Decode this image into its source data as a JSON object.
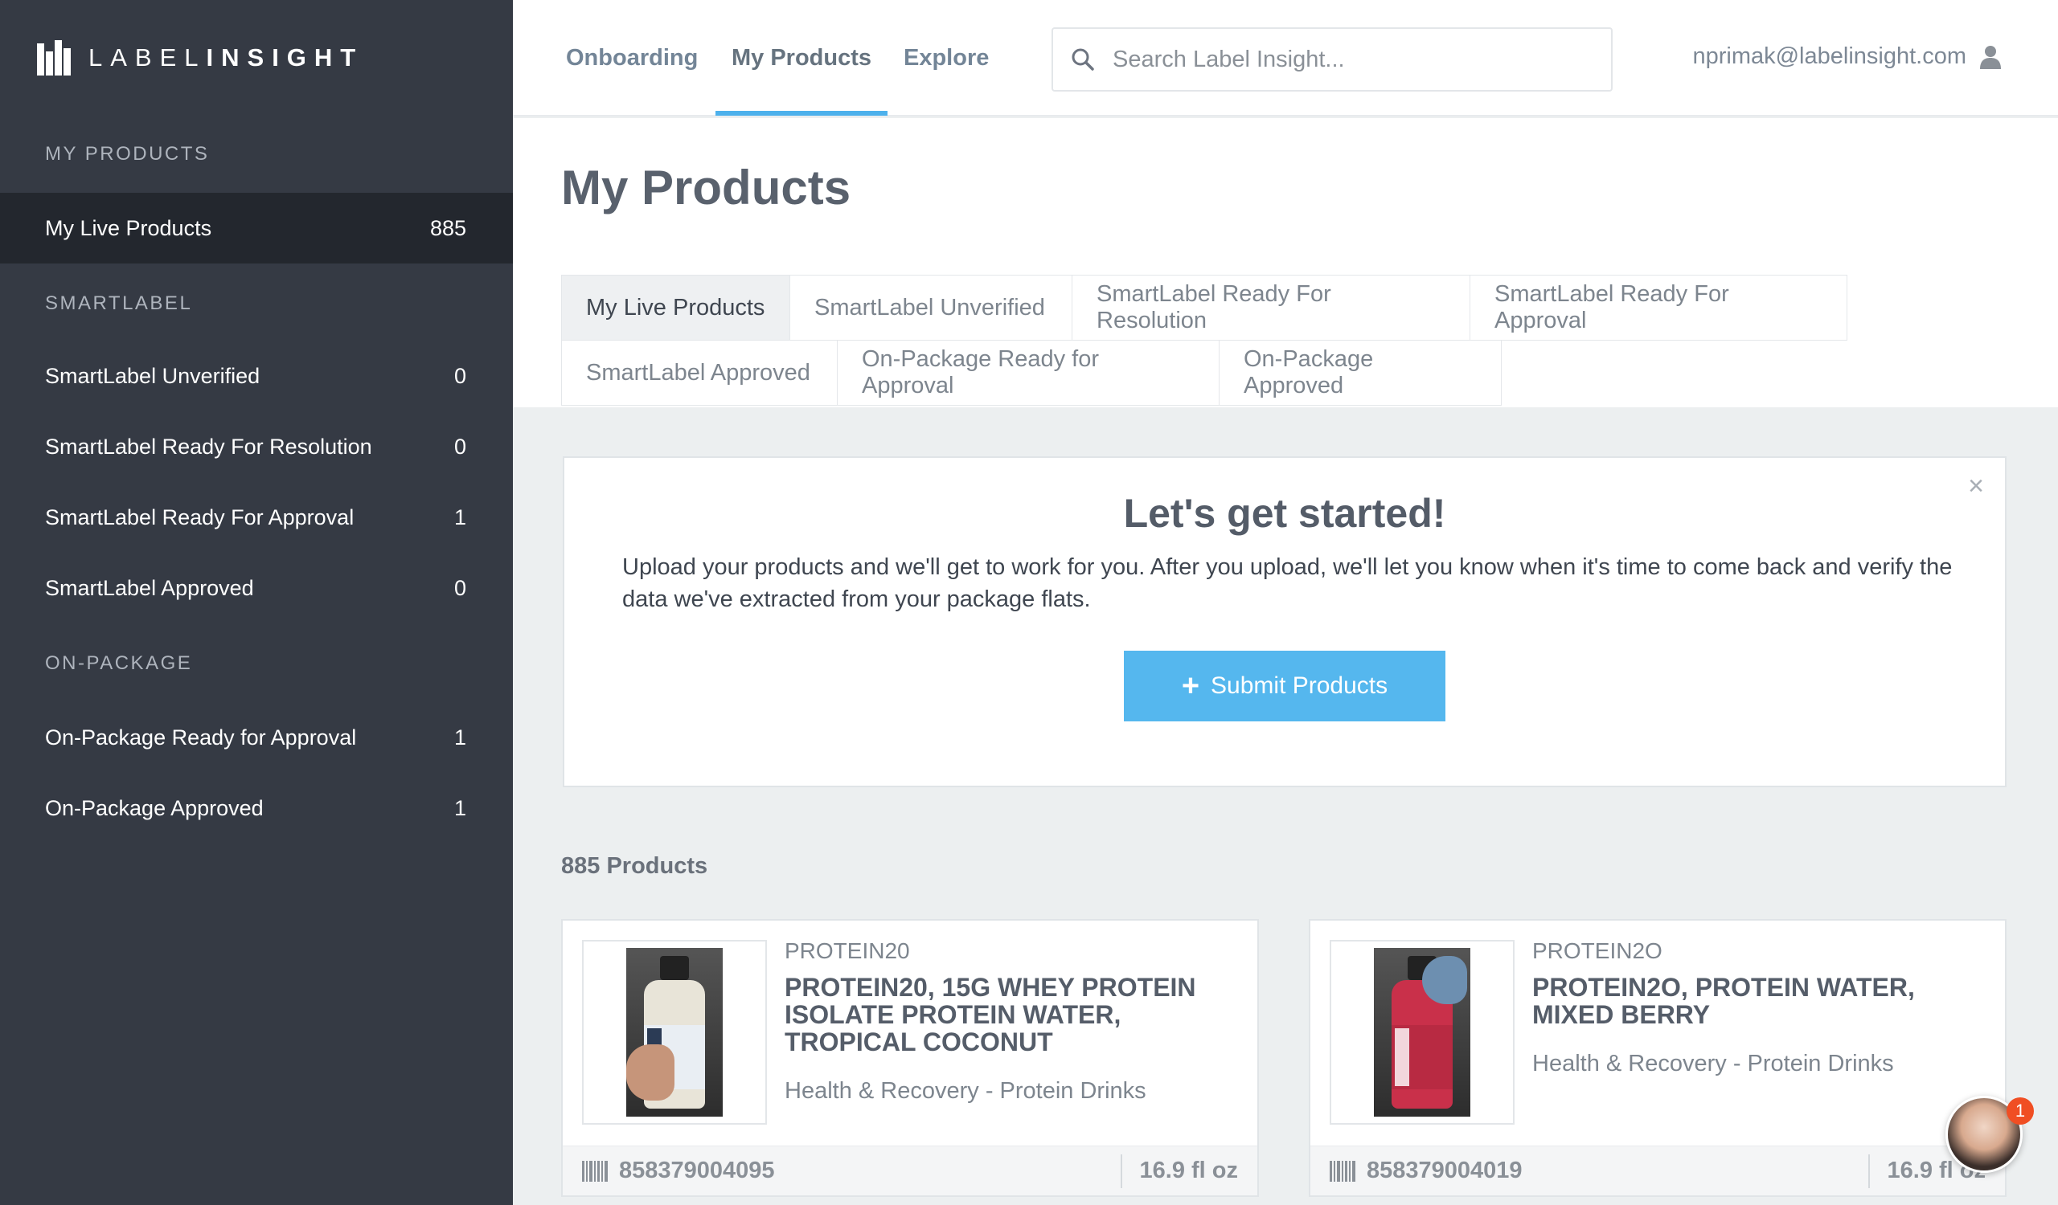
{
  "app": {
    "logo_text_light": "LABEL",
    "logo_text_bold": "INSIGHT"
  },
  "sidebar": {
    "sections": [
      {
        "heading": "MY PRODUCTS"
      },
      {
        "heading": "SMARTLABEL"
      },
      {
        "heading": "ON-PACKAGE"
      }
    ],
    "items": [
      {
        "label": "My Live Products",
        "count": "885",
        "active": true
      },
      {
        "label": "SmartLabel Unverified",
        "count": "0"
      },
      {
        "label": "SmartLabel Ready For Resolution",
        "count": "0"
      },
      {
        "label": "SmartLabel Ready For Approval",
        "count": "1"
      },
      {
        "label": "SmartLabel Approved",
        "count": "0"
      },
      {
        "label": "On-Package Ready for Approval",
        "count": "1"
      },
      {
        "label": "On-Package Approved",
        "count": "1"
      }
    ]
  },
  "topnav": {
    "links": [
      "Onboarding",
      "My Products",
      "Explore"
    ],
    "active": "My Products",
    "search_placeholder": "Search Label Insight...",
    "user_email": "nprimak@labelinsight.com"
  },
  "main": {
    "title": "My Products",
    "tabs": [
      "My Live Products",
      "SmartLabel Unverified",
      "SmartLabel Ready For Resolution",
      "SmartLabel Ready For Approval",
      "SmartLabel Approved",
      "On-Package Ready for Approval",
      "On-Package Approved"
    ],
    "active_tab": "My Live Products"
  },
  "banner": {
    "title": "Let's get started!",
    "text": "Upload your products and we'll get to work for you. After you upload, we'll let you know when it's time to come back and verify the data we've extracted from your package flats.",
    "button_label": "Submit Products",
    "close_glyph": "×"
  },
  "products": {
    "count_label": "885 Products",
    "items": [
      {
        "brand": "PROTEIN20",
        "name": "PROTEIN20, 15G WHEY PROTEIN ISOLATE PROTEIN WATER, TROPICAL COCONUT",
        "category": "Health & Recovery - Protein Drinks",
        "upc": "858379004095",
        "size": "16.9 fl oz",
        "bottle_color": "#e8e4d8"
      },
      {
        "brand": "PROTEIN2O",
        "name": "PROTEIN2O, PROTEIN WATER, MIXED BERRY",
        "category": "Health & Recovery - Protein Drinks",
        "upc": "858379004019",
        "size": "16.9 fl oz",
        "bottle_color": "#c9304a"
      }
    ]
  },
  "chat": {
    "badge": "1"
  },
  "colors": {
    "sidebar_bg": "#353a44",
    "sidebar_active": "#23272e",
    "accent": "#55b7ee",
    "page_bg": "#eceff0"
  }
}
